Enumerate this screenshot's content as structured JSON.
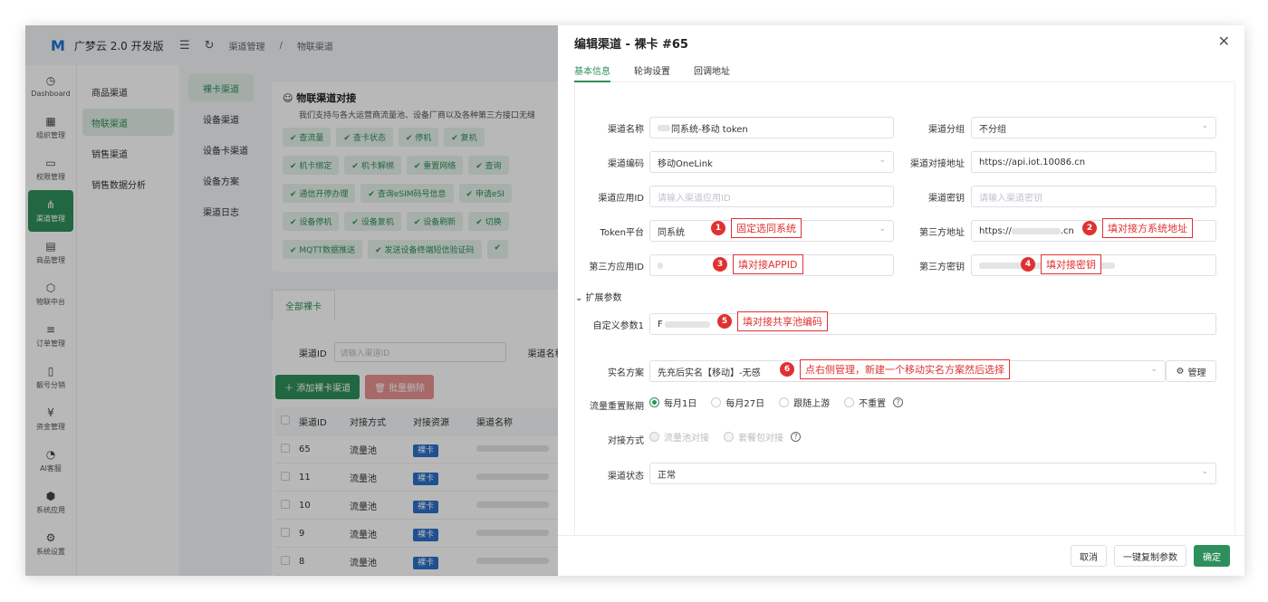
{
  "app": {
    "logo_mark": "M",
    "name": "广梦云 2.0 开发版",
    "breadcrumb": [
      "渠道管理",
      "/",
      "物联渠道"
    ]
  },
  "rail": [
    {
      "icon": "◷",
      "label": "Dashboard"
    },
    {
      "icon": "▦",
      "label": "组织管理"
    },
    {
      "icon": "▭",
      "label": "权限管理"
    },
    {
      "icon": "⋔",
      "label": "渠道管理",
      "active": true
    },
    {
      "icon": "▤",
      "label": "商品管理"
    },
    {
      "icon": "⬡",
      "label": "物联中台"
    },
    {
      "icon": "≡",
      "label": "订单管理"
    },
    {
      "icon": "▯",
      "label": "靓号分销"
    },
    {
      "icon": "¥",
      "label": "资金管理"
    },
    {
      "icon": "◔",
      "label": "AI客服"
    },
    {
      "icon": "⬢",
      "label": "系统应用"
    },
    {
      "icon": "⚙",
      "label": "系统设置"
    }
  ],
  "sub1": [
    "商品渠道",
    "物联渠道",
    "销售渠道",
    "销售数据分析"
  ],
  "sub2": [
    "裸卡渠道",
    "设备渠道",
    "设备卡渠道",
    "设备方案",
    "渠道日志"
  ],
  "panel": {
    "title": "物联渠道对接",
    "desc": "我们支持与各大运营商流量池、设备厂商以及各种第三方接口无缝",
    "tag_rows": [
      [
        "查流量",
        "查卡状态",
        "停机",
        "复机"
      ],
      [
        "机卡绑定",
        "机卡解绑",
        "重置网络",
        "查询"
      ],
      [
        "通信开停办理",
        "查询eSIM码号信息",
        "申请eSI"
      ],
      [
        "设备停机",
        "设备复机",
        "设备刷新",
        "切换"
      ],
      [
        "MQTT数据推送",
        "发送设备终端短信验证码",
        ""
      ]
    ]
  },
  "lower": {
    "tab": "全部裸卡",
    "search_label": "渠道ID",
    "search_placeholder": "请输入渠道ID",
    "search_label2": "渠道名称",
    "add_button": "添加裸卡渠道",
    "delete_button": "批量删除",
    "columns": [
      "渠道ID",
      "对接方式",
      "对接资源",
      "渠道名称"
    ],
    "rows": [
      {
        "id": "65",
        "mode": "流量池",
        "res": "裸卡"
      },
      {
        "id": "11",
        "mode": "流量池",
        "res": "裸卡"
      },
      {
        "id": "10",
        "mode": "流量池",
        "res": "裸卡"
      },
      {
        "id": "9",
        "mode": "流量池",
        "res": "裸卡"
      },
      {
        "id": "8",
        "mode": "流量池",
        "res": "裸卡"
      }
    ]
  },
  "drawer": {
    "title": "编辑渠道 - 裸卡 #65",
    "tabs": [
      "基本信息",
      "轮询设置",
      "回调地址"
    ],
    "fields": {
      "channel_name_label": "渠道名称",
      "channel_name_value": "同系统-移动 token",
      "group_label": "渠道分组",
      "group_value": "不分组",
      "code_label": "渠道编码",
      "code_value": "移动OneLink",
      "url_label": "渠道对接地址",
      "url_value": "https://api.iot.10086.cn",
      "appid_label": "渠道应用ID",
      "appid_placeholder": "请输入渠道应用ID",
      "secret_label": "渠道密钥",
      "secret_placeholder": "请输入渠道密钥",
      "token_label": "Token平台",
      "token_value": "同系统",
      "third_url_label": "第三方地址",
      "third_url_value": "https://",
      "third_url_suffix": ".cn",
      "third_appid_label": "第三方应用ID",
      "third_appid_value": "",
      "third_secret_label": "第三方密钥",
      "third_secret_value": "",
      "ext_label": "扩展参数",
      "custom_label": "自定义参数1",
      "custom_value": "F",
      "realname_label": "实名方案",
      "realname_value": "先充后实名【移动】-无感",
      "manage_label": "管理",
      "reset_label": "流量重置账期",
      "reset_options": [
        "每月1日",
        "每月27日",
        "跟随上游",
        "不重置"
      ],
      "mode_label": "对接方式",
      "mode_options": [
        "流量池对接",
        "套餐包对接"
      ],
      "status_label": "渠道状态",
      "status_value": "正常"
    },
    "callouts": [
      {
        "n": "1",
        "text": "固定选同系统"
      },
      {
        "n": "2",
        "text": "填对接方系统地址"
      },
      {
        "n": "3",
        "text": "填对接APPID"
      },
      {
        "n": "4",
        "text": "填对接密钥"
      },
      {
        "n": "5",
        "text": "填对接共享池编码"
      },
      {
        "n": "6",
        "text": "点右侧管理，新建一个移动实名方案然后选择"
      }
    ],
    "footer": {
      "cancel": "取消",
      "copy": "一键复制参数",
      "ok": "确定"
    }
  },
  "colors": {
    "accent": "#2f8f5b",
    "callout": "#e03131",
    "chip": "#2b6fc9"
  }
}
